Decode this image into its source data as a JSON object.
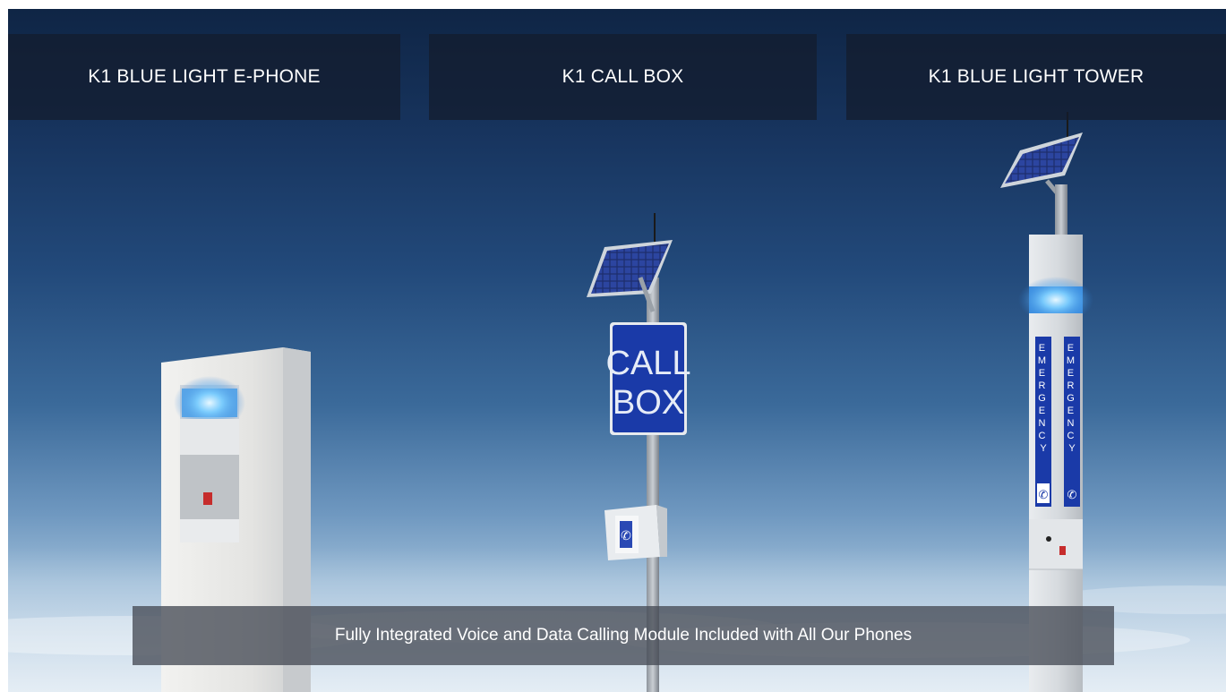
{
  "tabs": [
    {
      "label": "K1 BLUE LIGHT E-PHONE"
    },
    {
      "label": "K1 CALL BOX"
    },
    {
      "label": "K1 BLUE LIGHT TOWER"
    }
  ],
  "call_box_sign": {
    "line1": "CALL",
    "line2": "BOX"
  },
  "tower_label": {
    "word": "EMERGENCY"
  },
  "caption": "Fully Integrated Voice and Data Calling Module Included with All Our Phones",
  "colors": {
    "beacon_blue": "#7fd0ff",
    "sign_blue": "#1a3aa8",
    "tab_bg": "#141c2c",
    "caption_bg": "#464c56"
  },
  "icons": [
    "phone-handset-icon",
    "solar-panel-icon",
    "blue-light-beacon-icon"
  ]
}
